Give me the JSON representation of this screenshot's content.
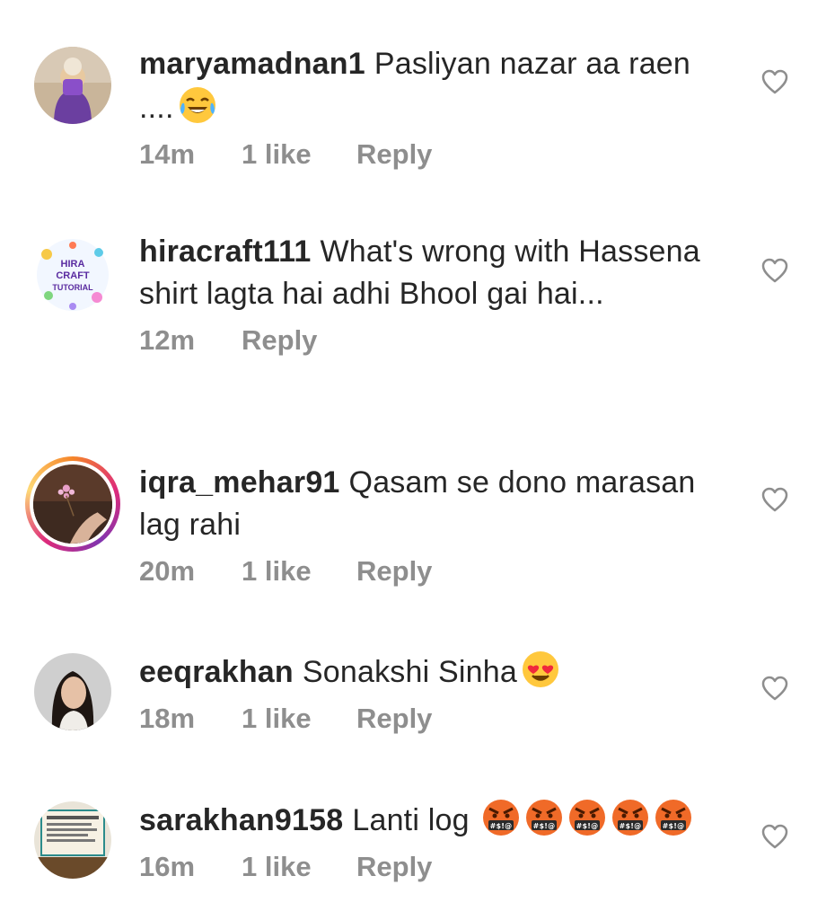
{
  "comments": [
    {
      "username": "maryamadnan1",
      "text": "Pasliyan nazar aa raen ....",
      "emoji": "tears-of-joy",
      "time": "14m",
      "likes": "1 like",
      "reply_label": "Reply"
    },
    {
      "username": "hiracraft111",
      "text": "What's wrong with Hassena shirt lagta hai adhi Bhool gai hai...",
      "time": "12m",
      "reply_label": "Reply",
      "avatar_text": "HIRA CRAFT TUTORIAL"
    },
    {
      "username": "iqra_mehar91",
      "text": "Qasam se dono marasan lag rahi",
      "time": "20m",
      "likes": "1 like",
      "reply_label": "Reply"
    },
    {
      "username": "eeqrakhan",
      "text": "Sonakshi Sinha",
      "emoji": "heart-eyes",
      "time": "18m",
      "likes": "1 like",
      "reply_label": "Reply"
    },
    {
      "username": "sarakhan9158",
      "text": "Lanti log",
      "emoji": "cursing-face x5",
      "time": "16m",
      "likes": "1 like",
      "reply_label": "Reply"
    }
  ],
  "colors": {
    "text": "#262626",
    "meta": "#8e8e8e",
    "heart_outline": "#8e8e8e",
    "story_ring": [
      "#f58529",
      "#dd2a7b",
      "#8134af"
    ]
  }
}
